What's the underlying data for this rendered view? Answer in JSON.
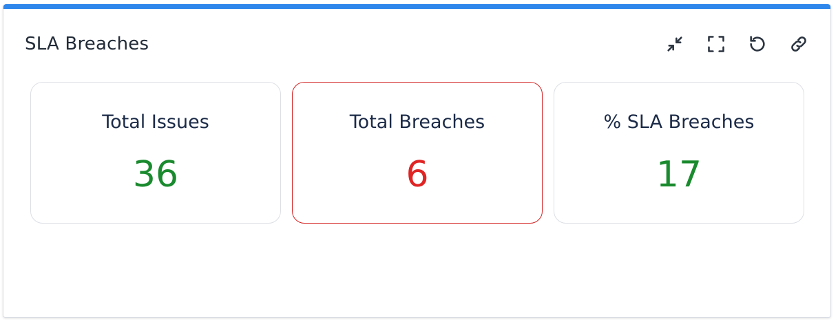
{
  "widget": {
    "title": "SLA Breaches",
    "accent_color": "#2f86eb"
  },
  "toolbar": {
    "buttons": [
      {
        "icon": "collapse-icon"
      },
      {
        "icon": "fullscreen-icon"
      },
      {
        "icon": "refresh-icon"
      },
      {
        "icon": "link-icon"
      }
    ]
  },
  "cards": [
    {
      "label": "Total Issues",
      "value": "36",
      "value_color": "#1a8a2e",
      "border_color": "#dcdfe4"
    },
    {
      "label": "Total Breaches",
      "value": "6",
      "value_color": "#e02424",
      "border_color": "#d32424"
    },
    {
      "label": "% SLA Breaches",
      "value": "17",
      "value_color": "#1a8a2e",
      "border_color": "#dcdfe4"
    }
  ]
}
